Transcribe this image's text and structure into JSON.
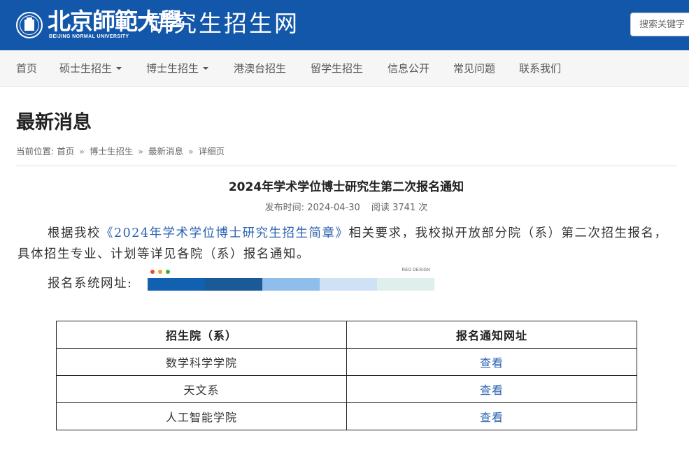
{
  "header": {
    "logo_cn": "北京師範大學",
    "logo_en": "BEIJING NORMAL UNIVERSITY",
    "site_name": "研究生招生网",
    "search_placeholder": "搜索关键字"
  },
  "nav": {
    "items": [
      {
        "label": "首页"
      },
      {
        "label": "硕士生招生",
        "dropdown": true
      },
      {
        "label": "博士生招生",
        "dropdown": true
      },
      {
        "label": "港澳台招生"
      },
      {
        "label": "留学生招生"
      },
      {
        "label": "信息公开"
      },
      {
        "label": "常见问题"
      },
      {
        "label": "联系我们"
      }
    ]
  },
  "page": {
    "title": "最新消息",
    "breadcrumb": {
      "prefix": "当前位置:",
      "items": [
        "首页",
        "博士生招生",
        "最新消息",
        "详细页"
      ],
      "separator": "»"
    }
  },
  "article": {
    "title": "2024年学术学位博士研究生第二次报名通知",
    "meta": {
      "published_label": "发布时间:",
      "published_date": "2024-04-30",
      "views_label": "阅读",
      "views_count": "3741",
      "views_unit": "次"
    },
    "para_before_link": "根据我校",
    "para_link": "《2024年学术学位博士研究生招生简章》",
    "para_after_link": "相关要求，我校拟开放部分院（系）第二次招生报名，具体招生专业、计划等详见各院（系）报名通知。",
    "reg_label": "报名系统网址:",
    "reg_image": {
      "caption": "RED DESIGN",
      "dot_colors": [
        "#e64b3c",
        "#f3a81d",
        "#3fae49"
      ],
      "swatch_colors": [
        "#1260b0",
        "#1a5a96",
        "#8fbdec",
        "#cfe1f4",
        "#dff0ec"
      ]
    }
  },
  "table": {
    "headers": [
      "招生院（系）",
      "报名通知网址"
    ],
    "rows": [
      {
        "dept": "数学科学学院",
        "link": "查看"
      },
      {
        "dept": "天文系",
        "link": "查看"
      },
      {
        "dept": "人工智能学院",
        "link": "查看"
      }
    ]
  },
  "colors": {
    "header_bg": "#1357ab",
    "nav_bg": "#f6f6f6",
    "link": "#2a62b0"
  }
}
